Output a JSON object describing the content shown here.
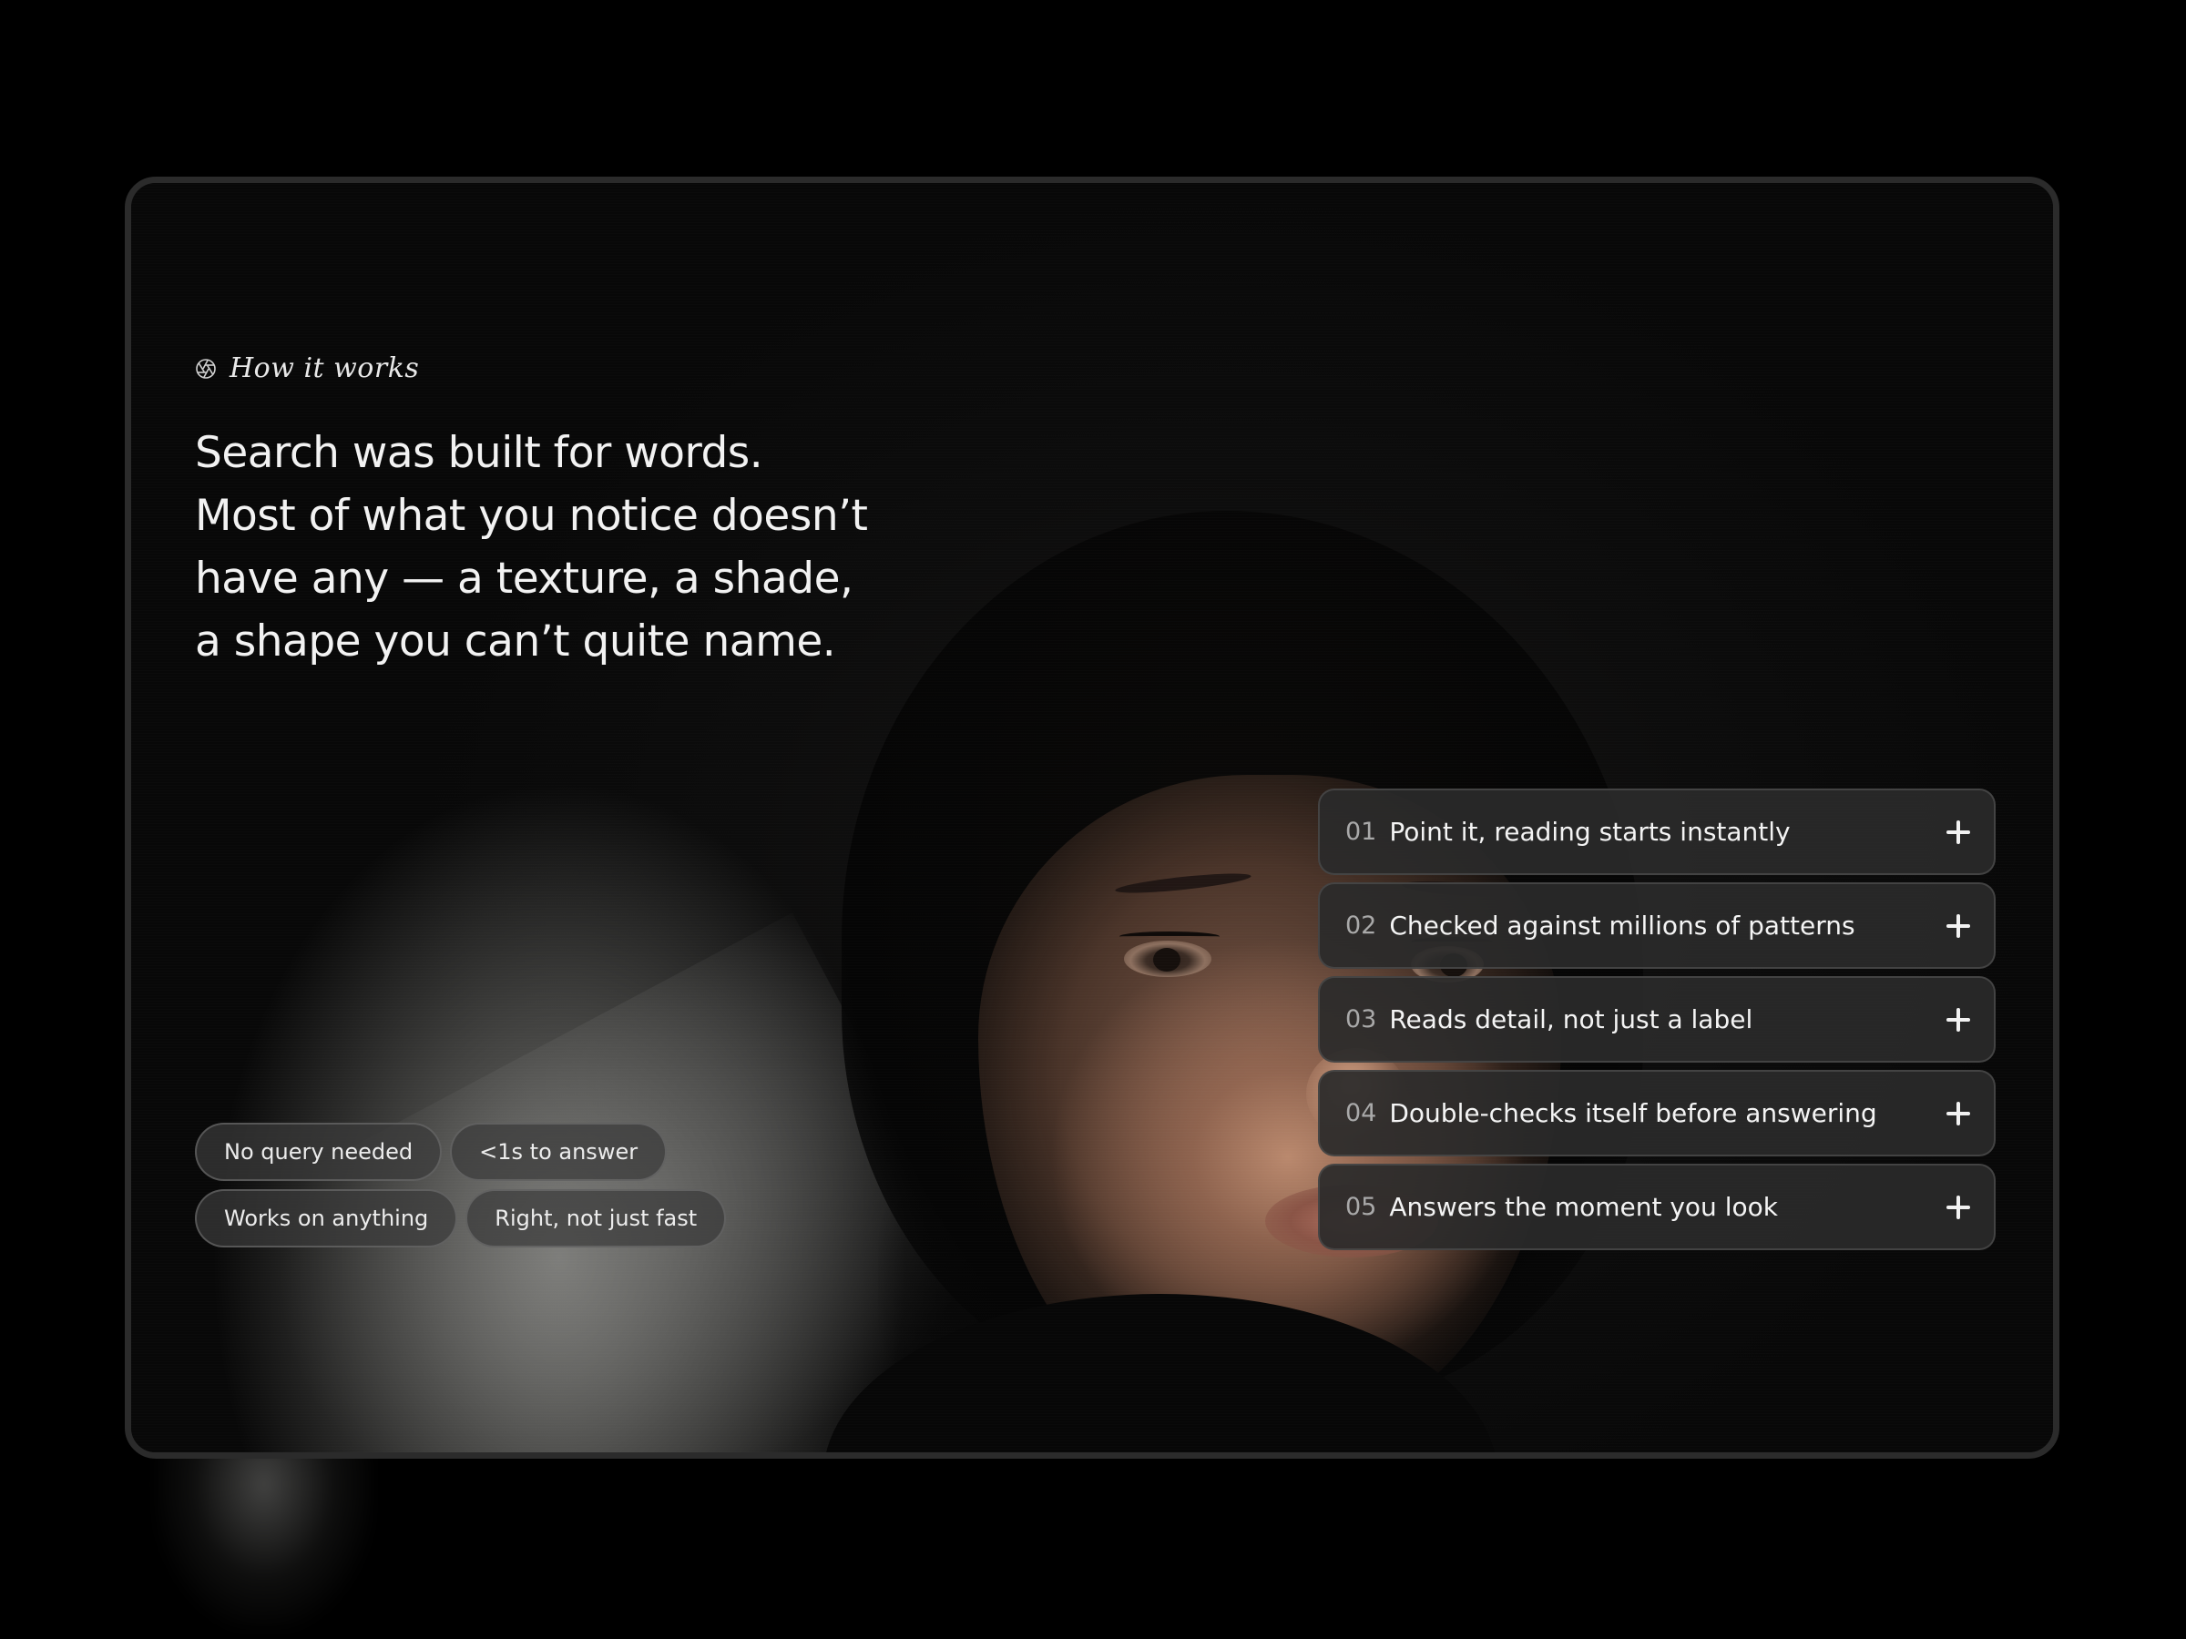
{
  "section": {
    "eyebrow_icon": "aperture-icon",
    "eyebrow": "How it works",
    "headline_lines": [
      "Search was built for words.",
      "Most of what you notice doesn’t",
      "have any — a texture, a shade,",
      "a shape you can’t quite name."
    ]
  },
  "chips": [
    [
      "No query needed",
      "<1s  to answer"
    ],
    [
      "Works on anything",
      "Right, not just fast"
    ]
  ],
  "steps": [
    {
      "number": "01",
      "title": "Point it, reading starts instantly",
      "icon": "plus-icon"
    },
    {
      "number": "02",
      "title": "Checked against millions of patterns",
      "icon": "plus-icon"
    },
    {
      "number": "03",
      "title": "Reads detail, not just a label",
      "icon": "plus-icon"
    },
    {
      "number": "04",
      "title": "Double-checks itself before answering",
      "icon": "plus-icon"
    },
    {
      "number": "05",
      "title": "Answers the moment you look",
      "icon": "plus-icon"
    }
  ],
  "colors": {
    "background": "#000000",
    "card_border": "#2b2b2b",
    "text": "#f2f2f2",
    "muted": "#a9a9a9"
  }
}
